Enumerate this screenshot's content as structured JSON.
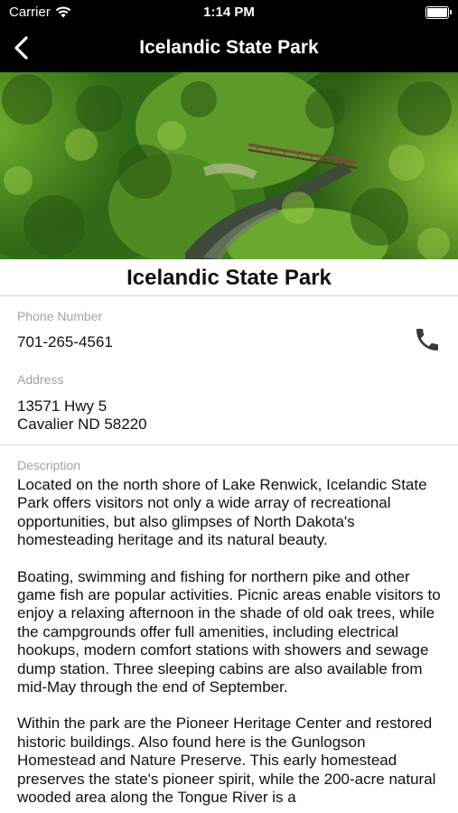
{
  "status_bar": {
    "carrier": "Carrier",
    "time": "1:14 PM"
  },
  "nav": {
    "title": "Icelandic State Park",
    "back_icon": "chevron-left-icon"
  },
  "park": {
    "name": "Icelandic State Park",
    "phone_label": "Phone Number",
    "phone": "701-265-4561",
    "address_label": "Address",
    "address_line1": "13571 Hwy 5",
    "address_line2": "Cavalier ND 58220",
    "description_label": "Description",
    "description": [
      "Located on the north shore of Lake Renwick, Icelandic State Park offers visitors not only a wide array of recreational opportunities, but also glimpses of North Dakota's homesteading heritage and its natural beauty.",
      "Boating, swimming and fishing for northern pike and other game fish are popular activities. Picnic areas enable visitors to enjoy a relaxing afternoon in the shade of old oak trees, while the campgrounds offer full amenities, including electrical hookups, modern comfort stations with showers and sewage dump station. Three sleeping cabins are also available from mid-May through the end of September.",
      "Within the park are the Pioneer Heritage Center and restored historic buildings. Also found here is the Gunlogson Homestead and Nature Preserve. This early homestead preserves the state's pioneer spirit, while the 200-acre natural wooded area along the Tongue River is a"
    ]
  },
  "colors": {
    "nav_bg": "#000000",
    "label": "#a3a3a3",
    "divider": "#d8d8d8",
    "phone_icon": "#3a3a3a"
  }
}
